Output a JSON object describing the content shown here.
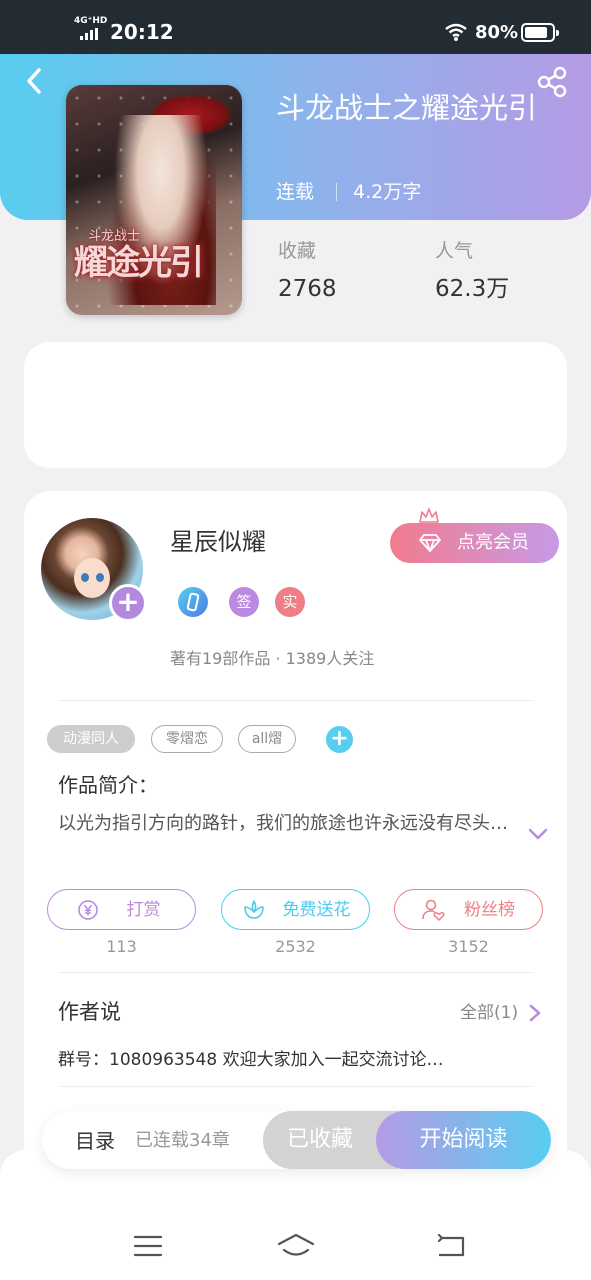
{
  "status_bar": {
    "network": "4G⁺HD",
    "time": "20:12",
    "battery": "80%"
  },
  "header": {
    "gradient_start": "#58cdf0",
    "gradient_end": "#b59be5"
  },
  "cover": {
    "title_art": "耀途光引",
    "subtitle_art": "斗龙战士"
  },
  "book": {
    "title": "斗龙战士之耀途光引",
    "status": "连载",
    "word_count": "4.2万字",
    "stats": [
      {
        "label": "收藏",
        "value": "2768"
      },
      {
        "label": "人气",
        "value": "62.3万"
      }
    ]
  },
  "author": {
    "name": "星辰似耀",
    "vip_button": "点亮会员",
    "badges": [
      "签",
      "实"
    ],
    "meta": "著有19部作品 · 1389人关注"
  },
  "tags": [
    "动漫同人",
    "零熠恋",
    "all熠"
  ],
  "intro": {
    "heading": "作品简介：",
    "text": "以光为指引方向的路针，我们的旅途也许永远没有尽头…"
  },
  "actions": [
    {
      "label": "打赏",
      "count": "113",
      "color": "#b98ae0"
    },
    {
      "label": "免费送花",
      "count": "2532",
      "color": "#4ecbeb"
    },
    {
      "label": "粉丝榜",
      "count": "3152",
      "color": "#ef7e86"
    }
  ],
  "author_says": {
    "heading": "作者说",
    "all_link": "全部(1)",
    "text": "群号：1080963548 欢迎大家加入一起交流讨论…"
  },
  "bottom_bar": {
    "toc": "目录",
    "toc_count": "已连载34章",
    "collected": "已收藏",
    "read": "开始阅读"
  }
}
